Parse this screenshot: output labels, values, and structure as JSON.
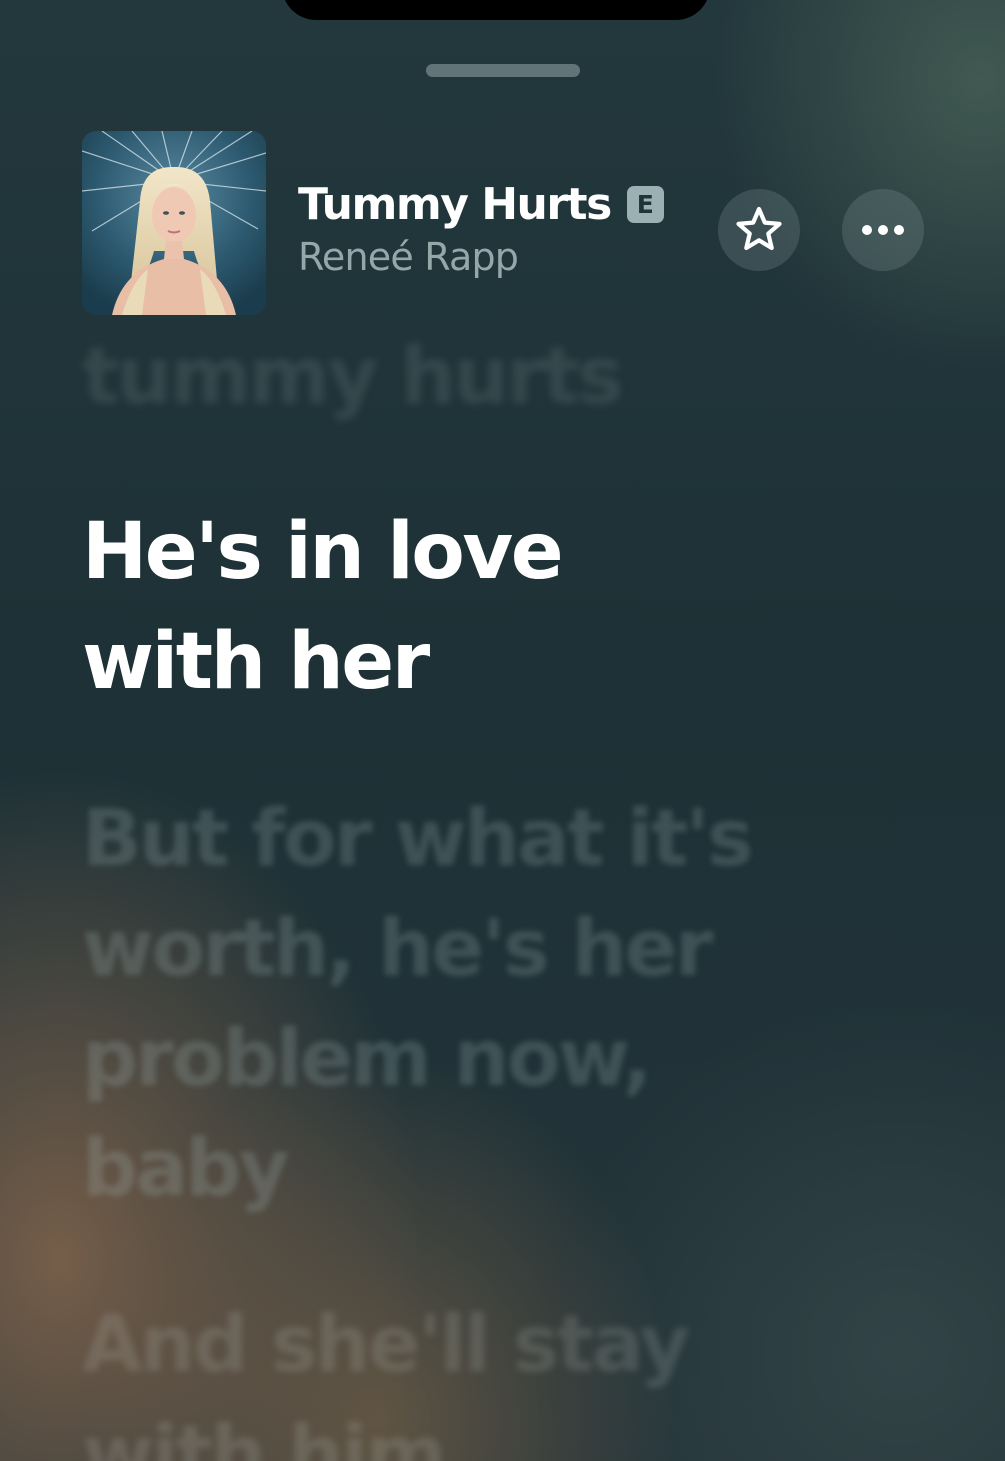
{
  "now_playing": {
    "title": "Tummy Hurts",
    "explicit_badge": "E",
    "artist": "Reneé Rapp",
    "artwork_icon": "album-artwork"
  },
  "actions": {
    "favorite_icon": "star-icon",
    "more_icon": "ellipsis-icon"
  },
  "lyrics": {
    "previous": "tummy hurts",
    "current": "He's in love with her",
    "next": "But for what it's worth, he's her problem now, baby",
    "upcoming": "And she'll stay with him"
  }
}
